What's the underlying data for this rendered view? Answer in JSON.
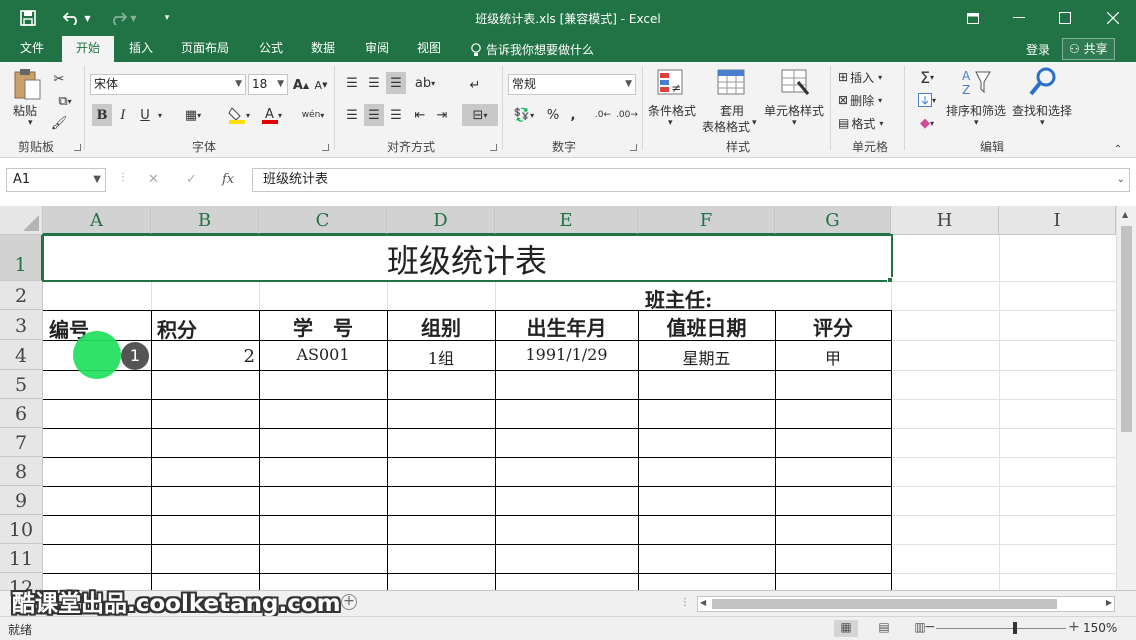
{
  "window": {
    "title": "班级统计表.xls  [兼容模式] - Excel",
    "controls": [
      "restore-ribbon",
      "minimize",
      "maximize",
      "close"
    ]
  },
  "menu": {
    "tabs": [
      {
        "label": "文件"
      },
      {
        "label": "开始"
      },
      {
        "label": "插入"
      },
      {
        "label": "页面布局"
      },
      {
        "label": "公式"
      },
      {
        "label": "数据"
      },
      {
        "label": "审阅"
      },
      {
        "label": "视图"
      }
    ],
    "active_tab": "开始",
    "tell_me": "告诉我你想要做什么",
    "login": "登录",
    "share": "共享"
  },
  "ribbon": {
    "clipboard": {
      "paste": "粘贴",
      "label": "剪贴板"
    },
    "font": {
      "name": "宋体",
      "size": "18",
      "bold": "B",
      "italic": "I",
      "underline": "U",
      "label": "字体"
    },
    "alignment": {
      "label": "对齐方式"
    },
    "number": {
      "format": "常规",
      "percent": "%",
      "comma": ",",
      "label": "数字"
    },
    "styles": {
      "conditional": "条件格式",
      "table_1": "套用",
      "table_2": "表格格式",
      "cell_styles": "单元格样式",
      "label": "样式"
    },
    "cells": {
      "insert": "插入",
      "delete": "删除",
      "format": "格式",
      "label": "单元格"
    },
    "editing": {
      "sort_filter": "排序和筛选",
      "find_select": "查找和选择",
      "label": "编辑"
    }
  },
  "formula_bar": {
    "name_box": "A1",
    "fx": "fx",
    "content": "班级统计表"
  },
  "sheet": {
    "columns": [
      "A",
      "B",
      "C",
      "D",
      "E",
      "F",
      "G",
      "H",
      "I"
    ],
    "rows": [
      "1",
      "2",
      "3",
      "4",
      "5",
      "6",
      "7",
      "8",
      "9",
      "10",
      "11",
      "12"
    ],
    "title": "班级统计表",
    "teacher_label": "班主任:",
    "headers": [
      "编号",
      "积分",
      "学　号",
      "组别",
      "出生年月",
      "值班日期",
      "评分"
    ],
    "row4": [
      "2",
      "AS001",
      "1组",
      "1991/1/29",
      "星期五",
      "甲"
    ]
  },
  "click_marker": {
    "count": "1"
  },
  "watermark": "酷课堂出品.coolketang.com",
  "status": {
    "text": "就绪",
    "zoom": "150%"
  }
}
